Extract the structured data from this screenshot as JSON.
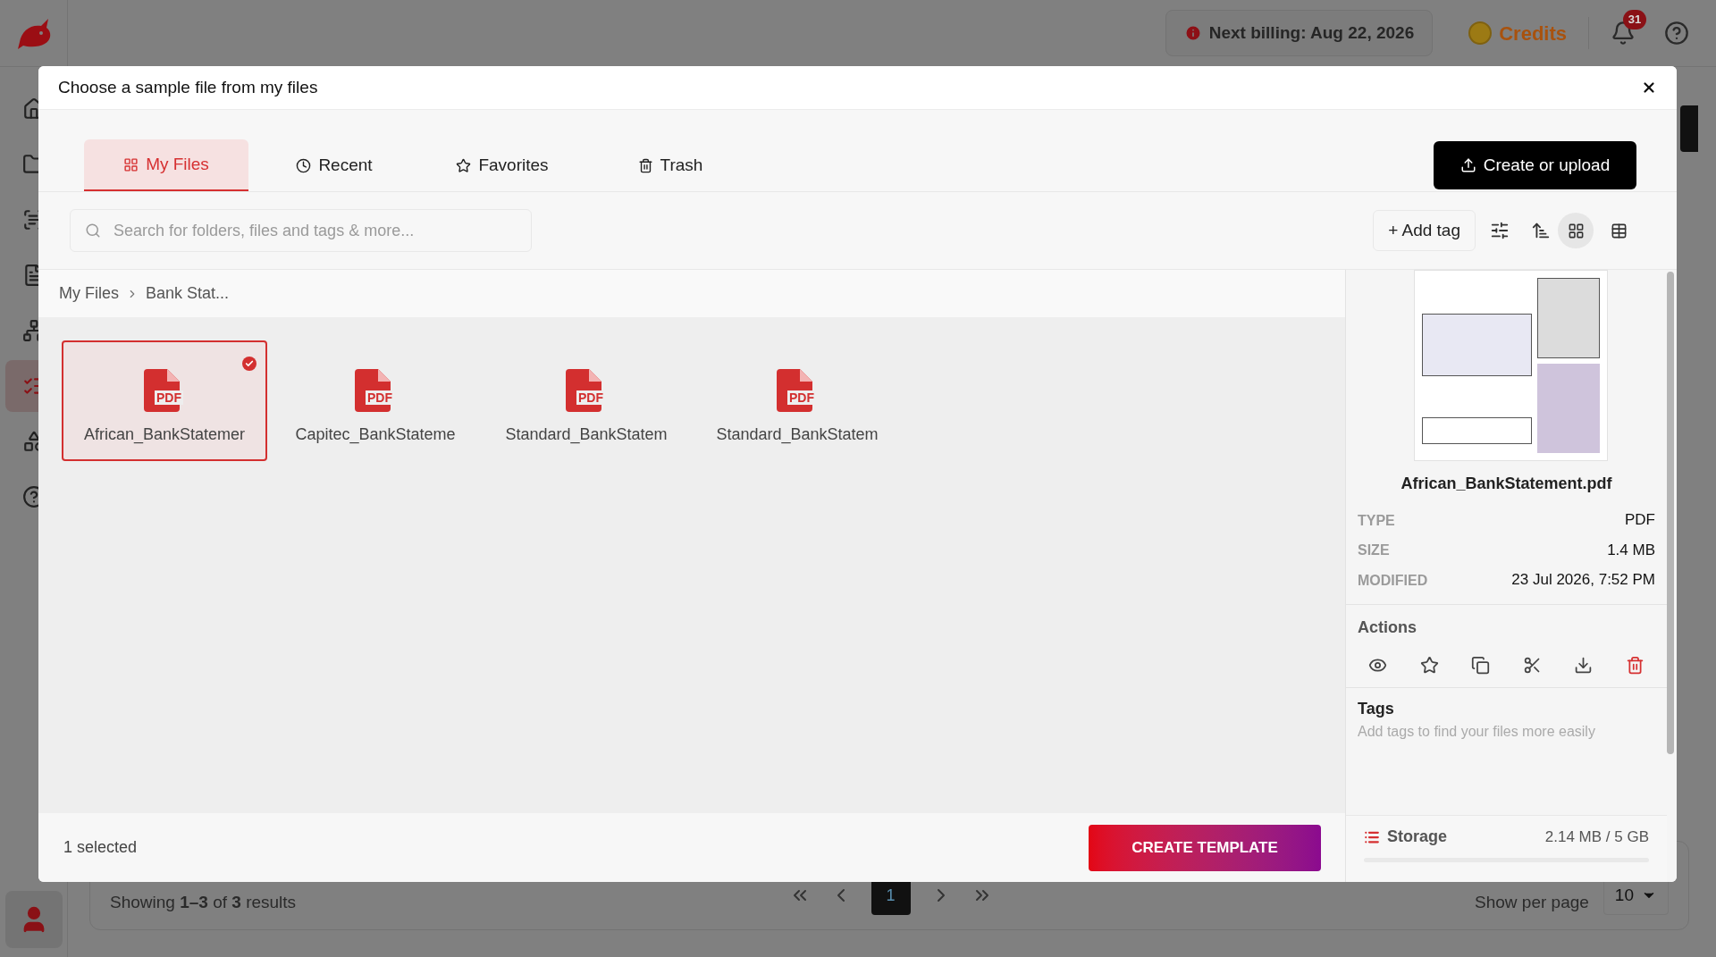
{
  "app": {
    "billing": "Next billing: Aug 22, 2026",
    "credits": "Credits",
    "notifications": "31",
    "sidebar": [
      {
        "selected": false
      },
      {
        "selected": false
      },
      {
        "selected": false
      },
      {
        "selected": false
      },
      {
        "selected": false
      },
      {
        "selected": true
      },
      {
        "selected": false
      },
      {
        "selected": false
      }
    ],
    "pagination": {
      "summary": "Showing **1–3** of **3** results",
      "pages": [
        {
          "label": "1",
          "selected": true
        }
      ],
      "per_page_label": "Show per page",
      "per_page": "10"
    }
  },
  "dialog": {
    "title": "Choose a sample file from my files",
    "tabs": [
      {
        "label": "My Files",
        "selected": true
      },
      {
        "label": "Recent",
        "selected": false
      },
      {
        "label": "Favorites",
        "selected": false
      },
      {
        "label": "Trash",
        "selected": false
      }
    ],
    "create_button": "Create or upload",
    "search": {
      "placeholder": "Search for folders, files and tags & more..."
    },
    "add_tag": "+ Add tag",
    "view_modes": [
      {
        "selected": true
      },
      {
        "selected": false
      }
    ],
    "breadcrumb": [
      "My Files",
      "Bank Stat..."
    ],
    "files": [
      {
        "name": "African_BankStatemer",
        "badge": "PDF",
        "selected": true
      },
      {
        "name": "Capitec_BankStateme",
        "badge": "PDF",
        "selected": false
      },
      {
        "name": "Standard_BankStatem",
        "badge": "PDF",
        "selected": false
      },
      {
        "name": "Standard_BankStatem",
        "badge": "PDF",
        "selected": false
      }
    ],
    "selection_count": "1 selected",
    "primary_button": "CREATE TEMPLATE",
    "details": {
      "name": "African_BankStatement.pdf",
      "fields": [
        {
          "label": "TYPE",
          "value": "PDF"
        },
        {
          "label": "SIZE",
          "value": "1.4 MB"
        },
        {
          "label": "MODIFIED",
          "value": "23 Jul 2026, 7:52 PM"
        }
      ],
      "actions_title": "Actions",
      "tags_title": "Tags",
      "tags_hint": "Add tags to find your files more easily",
      "storage_label": "Storage",
      "storage_value": "2.14 MB / 5 GB"
    }
  }
}
